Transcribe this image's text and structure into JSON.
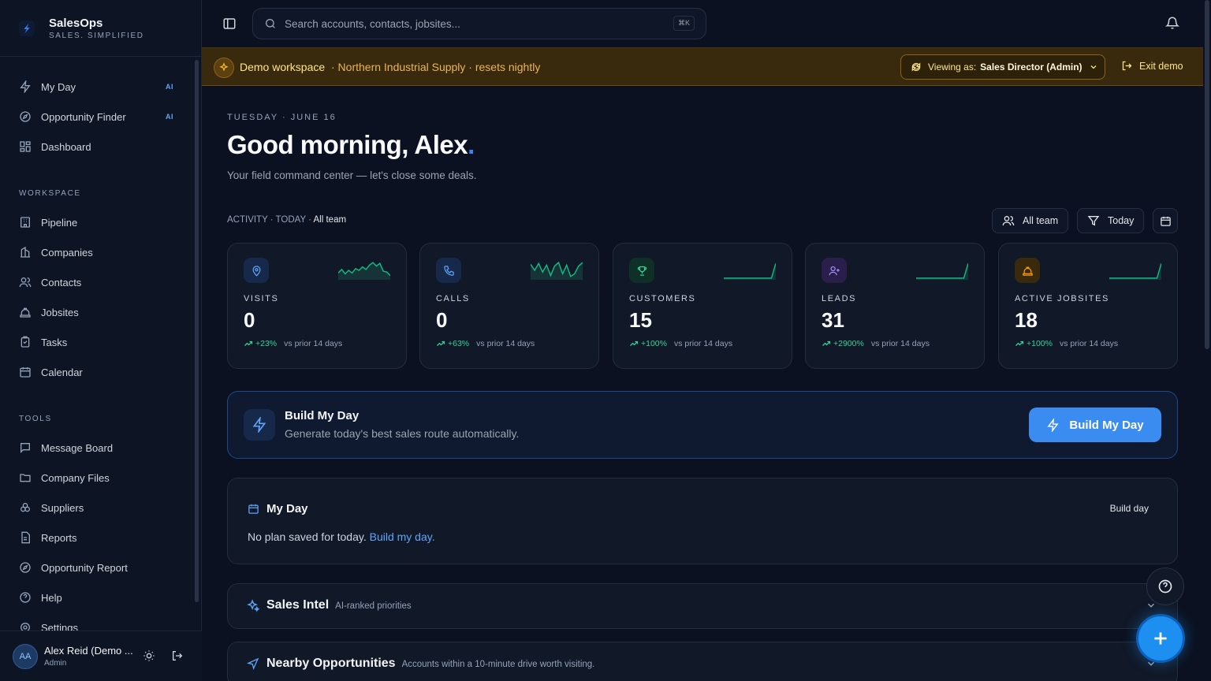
{
  "brand": {
    "name": "SalesOps",
    "tagline": "SALES. SIMPLIFIED"
  },
  "sidebar": {
    "top_items": [
      {
        "label": "My Day",
        "badge": "AI",
        "icon": "lightning-icon"
      },
      {
        "label": "Opportunity Finder",
        "badge": "AI",
        "icon": "compass-icon"
      },
      {
        "label": "Dashboard",
        "icon": "dashboard-icon"
      }
    ],
    "workspace_label": "WORKSPACE",
    "workspace_items": [
      {
        "label": "Pipeline",
        "icon": "building-icon"
      },
      {
        "label": "Companies",
        "icon": "buildings-icon"
      },
      {
        "label": "Contacts",
        "icon": "users-icon"
      },
      {
        "label": "Jobsites",
        "icon": "hardhat-icon"
      },
      {
        "label": "Tasks",
        "icon": "clipboard-icon"
      },
      {
        "label": "Calendar",
        "icon": "calendar-icon"
      }
    ],
    "tools_label": "TOOLS",
    "tools_items": [
      {
        "label": "Message Board",
        "icon": "message-icon"
      },
      {
        "label": "Company Files",
        "icon": "folder-icon"
      },
      {
        "label": "Suppliers",
        "icon": "boxes-icon"
      },
      {
        "label": "Reports",
        "icon": "report-icon"
      },
      {
        "label": "Opportunity Report",
        "icon": "compass-icon"
      },
      {
        "label": "Help",
        "icon": "help-icon"
      },
      {
        "label": "Settings",
        "icon": "gear-icon"
      }
    ]
  },
  "user": {
    "initials": "AA",
    "name": "Alex Reid (Demo ...",
    "role": "Admin"
  },
  "search": {
    "placeholder": "Search accounts, contacts, jobsites...",
    "shortcut": "⌘K"
  },
  "banner": {
    "title": "Demo workspace",
    "subtitle": "· Northern Industrial Supply · resets nightly",
    "viewing_prefix": "Viewing as:",
    "viewing_role": "Sales Director (Admin)",
    "exit_label": "Exit demo"
  },
  "header": {
    "date": "TUESDAY · JUNE 16",
    "greeting": "Good morning, Alex",
    "subtitle": "Your field command center — let's close some deals."
  },
  "activity": {
    "label": "ACTIVITY · TODAY · ",
    "scope": "All team",
    "team_filter": "All team",
    "date_filter": "Today"
  },
  "stats": [
    {
      "label": "VISITS",
      "value": "0",
      "trend": "+23%",
      "vs": "vs prior 14 days",
      "icon": "map-pin-icon",
      "color": "#60a5fa",
      "spark": [
        0.35,
        0.55,
        0.3,
        0.5,
        0.35,
        0.6,
        0.5,
        0.7,
        0.55,
        0.8,
        0.95,
        0.75,
        0.9,
        0.45,
        0.4,
        0.2
      ]
    },
    {
      "label": "CALLS",
      "value": "0",
      "trend": "+63%",
      "vs": "vs prior 14 days",
      "icon": "phone-icon",
      "color": "#60a5fa",
      "spark": [
        0.85,
        0.5,
        0.9,
        0.4,
        0.8,
        0.2,
        0.75,
        0.95,
        0.3,
        0.8,
        0.15,
        0.3,
        0.75,
        0.95
      ]
    },
    {
      "label": "CUSTOMERS",
      "value": "15",
      "trend": "+100%",
      "vs": "vs prior 14 days",
      "icon": "trophy-icon",
      "color": "#34d399",
      "spark": [
        0.05,
        0.05,
        0.05,
        0.05,
        0.05,
        0.05,
        0.05,
        0.05,
        0.05,
        0.05,
        0.05,
        0.05,
        0.9
      ]
    },
    {
      "label": "LEADS",
      "value": "31",
      "trend": "+2900%",
      "vs": "vs prior 14 days",
      "icon": "user-plus-icon",
      "color": "#a78bfa",
      "spark": [
        0.05,
        0.05,
        0.05,
        0.05,
        0.05,
        0.05,
        0.05,
        0.05,
        0.05,
        0.05,
        0.05,
        0.05,
        0.9
      ]
    },
    {
      "label": "ACTIVE JOBSITES",
      "value": "18",
      "trend": "+100%",
      "vs": "vs prior 14 days",
      "icon": "hardhat-icon",
      "color": "#f59e0b",
      "spark": [
        0.05,
        0.05,
        0.05,
        0.05,
        0.05,
        0.05,
        0.05,
        0.05,
        0.05,
        0.05,
        0.05,
        0.05,
        0.9
      ]
    }
  ],
  "build": {
    "title": "Build My Day",
    "subtitle": "Generate today's best sales route automatically.",
    "button": "Build My Day"
  },
  "myday": {
    "title": "My Day",
    "button": "Build day",
    "empty_text": "No plan saved for today.",
    "empty_link": "Build my day."
  },
  "panels": [
    {
      "title": "Sales Intel",
      "subtitle": "AI-ranked priorities",
      "icon": "sparkle-icon"
    },
    {
      "title": "Nearby Opportunities",
      "subtitle": "Accounts within a 10-minute drive worth visiting.",
      "icon": "navigation-icon"
    }
  ],
  "colors": {
    "accent": "#3b8cf0",
    "positive": "#34d399",
    "banner": "#3a2a0d"
  }
}
